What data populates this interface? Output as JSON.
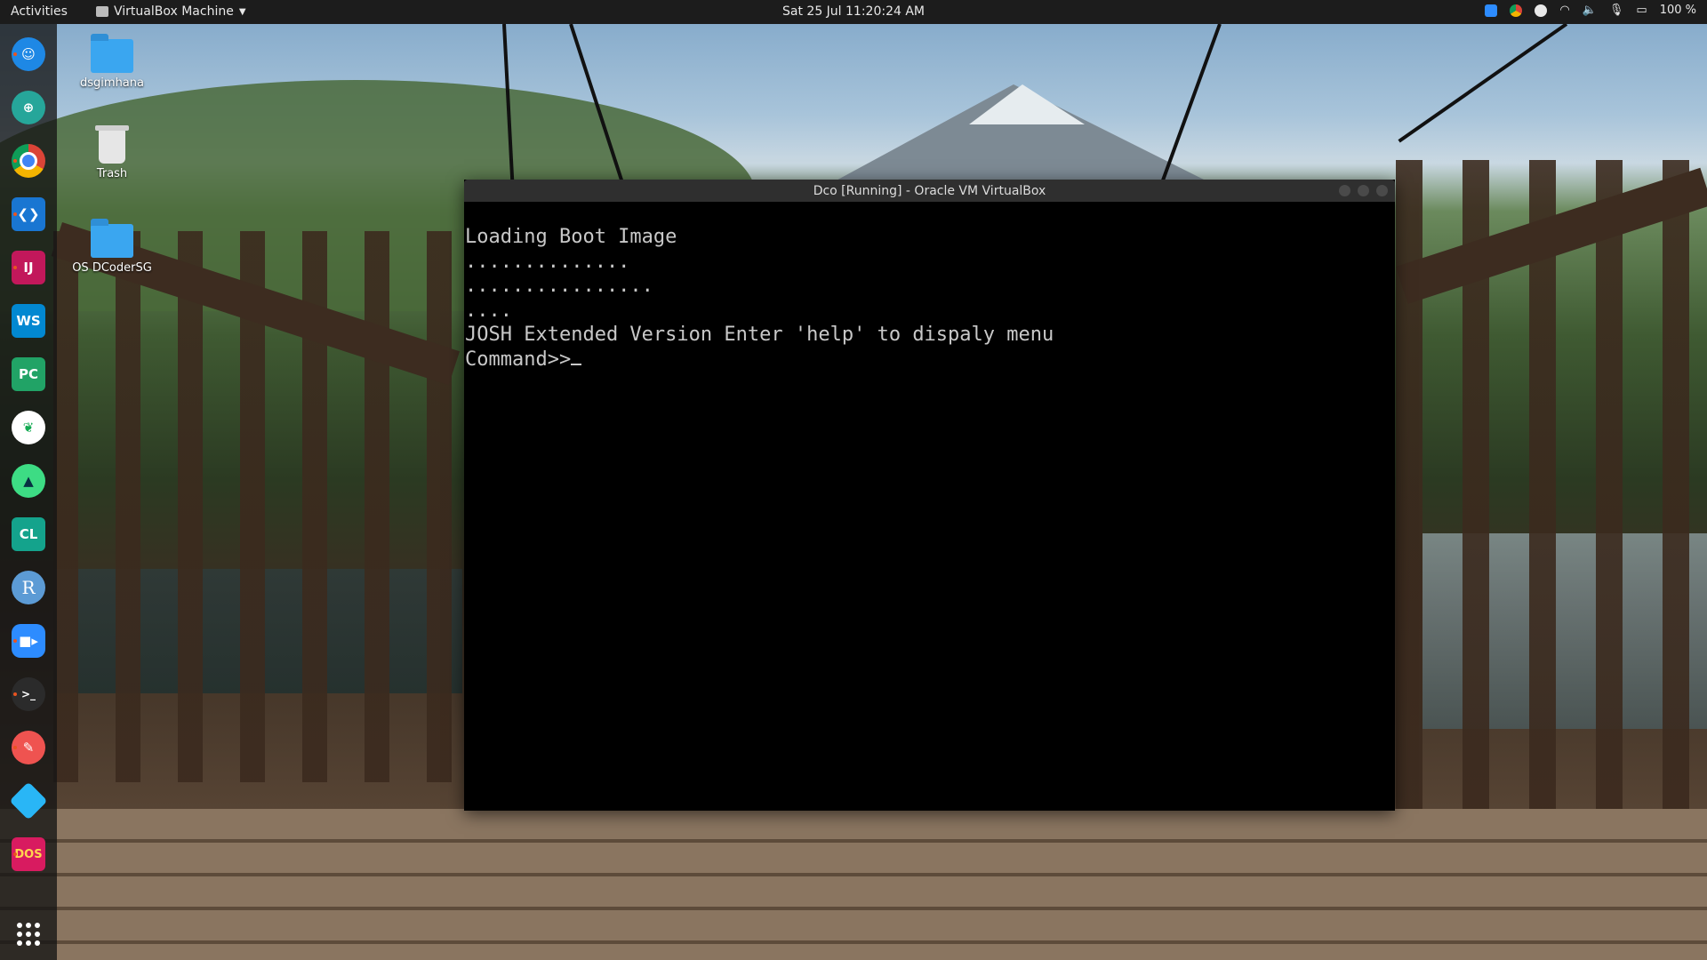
{
  "topbar": {
    "activities": "Activities",
    "app_name": "VirtualBox Machine",
    "clock": "Sat 25 Jul  11:20:24 AM",
    "battery": "100 %",
    "tray_icons": [
      "zoom-icon",
      "chrome-icon",
      "notification-icon",
      "wifi-icon",
      "volume-icon",
      "microphone-icon",
      "battery-icon"
    ]
  },
  "dock": {
    "items": [
      {
        "name": "finder-like-icon",
        "color": "#1e88e5"
      },
      {
        "name": "web-app-icon",
        "color": "#26a69a"
      },
      {
        "name": "chrome-icon",
        "color": "#db4437"
      },
      {
        "name": "vscode-icon",
        "color": "#1976d2"
      },
      {
        "name": "intellij-icon",
        "color": "#c2185b",
        "label": "IJ"
      },
      {
        "name": "webstorm-icon",
        "color": "#0288d1",
        "label": "WS"
      },
      {
        "name": "pycharm-icon",
        "color": "#21d789",
        "label": "PC"
      },
      {
        "name": "mongodb-compass-icon",
        "color": "#ffffff"
      },
      {
        "name": "android-studio-icon",
        "color": "#3ddc84"
      },
      {
        "name": "clion-icon",
        "color": "#22d3a6",
        "label": "CL"
      },
      {
        "name": "r-studio-icon",
        "color": "#5c9bd5",
        "label": "R"
      },
      {
        "name": "zoom-icon",
        "color": "#2d8cff"
      },
      {
        "name": "terminal-icon",
        "color": "#2b2b2b"
      },
      {
        "name": "text-editor-icon",
        "color": "#ef5350"
      },
      {
        "name": "virtualbox-icon",
        "color": "#29b6f6"
      },
      {
        "name": "dosbox-icon",
        "color": "#d81b60",
        "label": "DOS"
      }
    ],
    "apps_grid": "show-applications-icon"
  },
  "desktop": {
    "icons": [
      {
        "label": "dsgimhana",
        "type": "home-folder-icon"
      },
      {
        "label": "Trash",
        "type": "trash-icon"
      },
      {
        "label": "OS DCoderSG",
        "type": "folder-icon"
      }
    ]
  },
  "vbox": {
    "title": "Dco [Running] - Oracle VM VirtualBox",
    "lines": [
      "Loading Boot Image",
      "..............",
      "................",
      "....",
      "JOSH Extended Version Enter 'help' to dispaly menu",
      "Command>>"
    ]
  }
}
